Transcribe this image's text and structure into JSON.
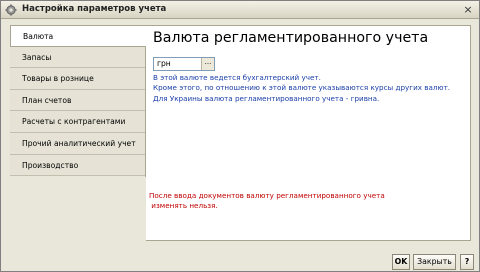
{
  "window": {
    "title": "Настройка параметров учета",
    "close_label": "×"
  },
  "sidebar": {
    "items": [
      {
        "label": "Валюта"
      },
      {
        "label": "Запасы"
      },
      {
        "label": "Товары в рознице"
      },
      {
        "label": "План счетов"
      },
      {
        "label": "Расчеты с контрагентами"
      },
      {
        "label": "Прочий аналитический учет"
      },
      {
        "label": "Производство"
      }
    ]
  },
  "main": {
    "heading": "Валюта регламентированного учета",
    "currency_field": {
      "value": "грн",
      "select_label": "..."
    },
    "info_lines": [
      "В этой валюте ведется бухгалтерский учет.",
      "Кроме этого, по отношению к этой валюте указываются курсы других валют.",
      "Для Украины валюта регламентированного учета - гривна."
    ],
    "warning_lines": [
      "После ввода документов валюту регламентированного учета",
      " изменять нельзя."
    ]
  },
  "footer": {
    "ok_label": "OK",
    "close_label": "Закрыть",
    "help_label": "?"
  },
  "colors": {
    "info_text": "#1a3ea8",
    "warning_text": "#c00000",
    "window_bg": "#e9e6da"
  }
}
